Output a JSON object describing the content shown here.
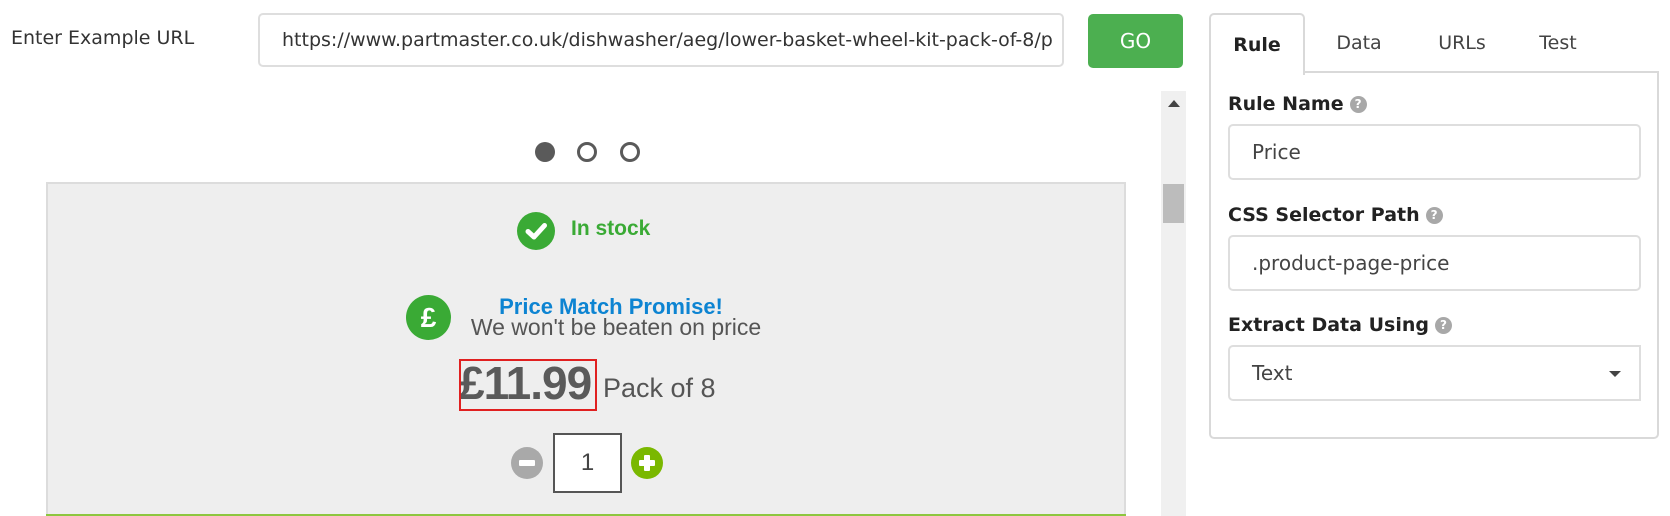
{
  "toolbar": {
    "url_label": "Enter Example URL",
    "url_value": "https://www.partmaster.co.uk/dishwasher/aeg/lower-basket-wheel-kit-pack-of-8/p",
    "go_label": "GO",
    "go_color": "#4caf50"
  },
  "preview": {
    "carousel": {
      "total": 3,
      "active_index": 0
    },
    "product": {
      "stock_status": "In stock",
      "stock_icon": "check-circle-icon",
      "promise_icon": "pound-circle-icon",
      "promise_title": "Price Match Promise!",
      "promise_subtitle": "We won't be beaten on price",
      "price": "£11.99",
      "pack_text": "Pack of 8",
      "quantity": "1",
      "highlight_color": "#e02020"
    }
  },
  "panel": {
    "tabs": [
      {
        "label": "Rule",
        "active": true
      },
      {
        "label": "Data",
        "active": false
      },
      {
        "label": "URLs",
        "active": false
      },
      {
        "label": "Test",
        "active": false
      }
    ],
    "fields": {
      "rule_name_label": "Rule Name",
      "rule_name_value": "Price",
      "css_selector_label": "CSS Selector Path",
      "css_selector_value": ".product-page-price",
      "extract_label": "Extract Data Using",
      "extract_value": "Text"
    },
    "help_glyph": "?"
  }
}
